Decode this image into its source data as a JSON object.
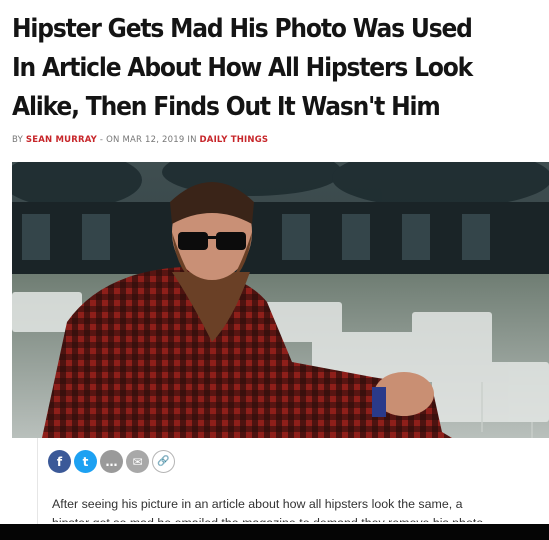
{
  "headline": "Hipster Gets Mad His Photo Was Used In Article About How All Hipsters Look Alike, Then Finds Out It Wasn't Him",
  "byline": {
    "prefix": "BY ",
    "author": "SEAN MURRAY",
    "middle": " - ON MAR 12, 2019 IN ",
    "category": "DAILY THINGS"
  },
  "share": {
    "icons": [
      {
        "name": "facebook-icon",
        "glyph": "f"
      },
      {
        "name": "twitter-icon",
        "glyph": "t"
      },
      {
        "name": "sms-icon",
        "glyph": "…"
      },
      {
        "name": "email-icon",
        "glyph": "✉"
      },
      {
        "name": "link-icon",
        "glyph": "🔗"
      }
    ]
  },
  "excerpt": {
    "line1": "After seeing his picture in an article about how all hipsters look the same, a",
    "line2": "hipster got so mad he emailed the magazine to demand they remove his photo"
  },
  "colors": {
    "headline": "#141414",
    "byline_accent": "#c7262a",
    "facebook": "#3b5998",
    "twitter": "#1da1f2"
  }
}
